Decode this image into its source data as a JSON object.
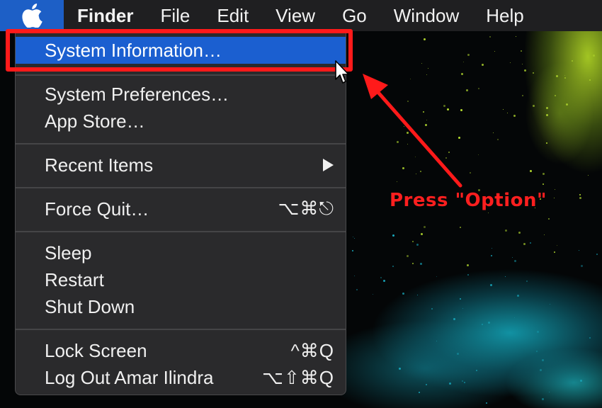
{
  "menubar": {
    "apple_icon": "apple-logo-icon",
    "items": [
      {
        "label": "Finder",
        "bold": true
      },
      {
        "label": "File"
      },
      {
        "label": "Edit"
      },
      {
        "label": "View"
      },
      {
        "label": "Go"
      },
      {
        "label": "Window"
      },
      {
        "label": "Help"
      }
    ]
  },
  "apple_menu": {
    "items": {
      "system_information": "System Information…",
      "system_preferences": "System Preferences…",
      "app_store": "App Store…",
      "recent_items": "Recent Items",
      "recent_items_submenu_icon": "triangle-right-icon",
      "force_quit": "Force Quit…",
      "force_quit_shortcut": "⌥⌘⎋",
      "sleep": "Sleep",
      "restart": "Restart",
      "shut_down": "Shut Down",
      "lock_screen": "Lock Screen",
      "lock_screen_shortcut": "^⌘Q",
      "log_out": "Log Out Amar Ilindra",
      "log_out_shortcut": "⌥⇧⌘Q"
    },
    "highlighted": "system_information"
  },
  "annotation": {
    "label": "Press \"Option\"",
    "color": "#ff1a1a"
  },
  "colors": {
    "menubar_bg": "#1f1f21",
    "menu_bg": "#2a2a2c",
    "highlight": "#1b5fd0",
    "accent_green": "#b8e030",
    "accent_teal": "#18a8bc"
  }
}
